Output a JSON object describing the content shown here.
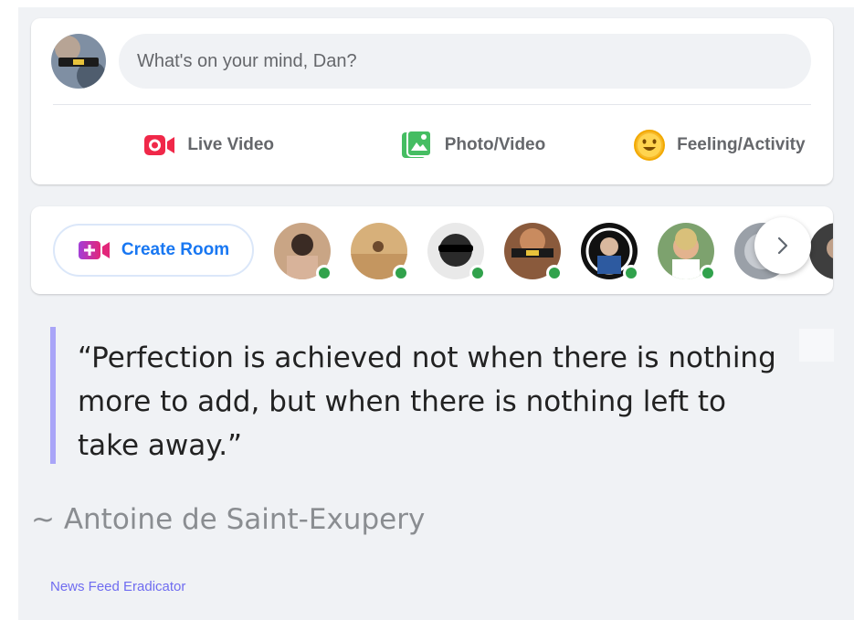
{
  "composer": {
    "placeholder": "What's on your mind, Dan?",
    "actions": [
      {
        "label": "Live Video",
        "icon": "live-video-icon",
        "color": "#f02849"
      },
      {
        "label": "Photo/Video",
        "icon": "photo-video-icon",
        "color": "#45bd62"
      },
      {
        "label": "Feeling/Activity",
        "icon": "feeling-icon",
        "color": "#f7b928"
      }
    ]
  },
  "rooms": {
    "create_label": "Create Room",
    "create_icon": "video-plus-icon",
    "accent": "#1877f2",
    "online_color": "#31a24c"
  },
  "quote": {
    "text": "“Perfection is achieved not when there is nothing more to add, but when there is nothing left to take away.”",
    "author": "~ Antoine de Saint-Exupery",
    "bar_color": "#a9a5f8"
  },
  "footer": {
    "credit": "News Feed Eradicator"
  }
}
